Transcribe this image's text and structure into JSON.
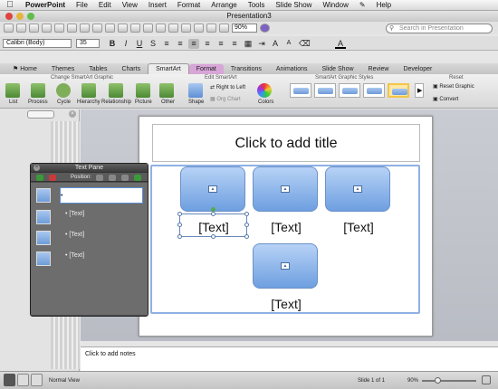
{
  "menubar": {
    "apple": "",
    "app": "PowerPoint",
    "items": [
      "File",
      "Edit",
      "View",
      "Insert",
      "Format",
      "Arrange",
      "Tools",
      "Slide Show",
      "Window"
    ],
    "help": "Help"
  },
  "window": {
    "title": "Presentation3"
  },
  "toolbar": {
    "zoom": "90%",
    "search_placeholder": "Search in Presentation"
  },
  "format_bar": {
    "font": "Calibri (Body)",
    "size": "35"
  },
  "ribbon": {
    "tabs": [
      "Home",
      "Themes",
      "Tables",
      "Charts",
      "SmartArt",
      "Format",
      "Transitions",
      "Animations",
      "Slide Show",
      "Review",
      "Developer"
    ],
    "group_titles": {
      "change": "Change SmartArt Graphic",
      "edit": "Edit SmartArt",
      "styles": "SmartArt Graphic Styles",
      "reset": "Reset"
    },
    "buttons": {
      "list": "List",
      "process": "Process",
      "cycle": "Cycle",
      "hierarchy": "Hierarchy",
      "relationship": "Relationship",
      "picture": "Picture",
      "other": "Other",
      "shape": "Shape",
      "right_to_left": "Right to Left",
      "org_chart": "Org Chart",
      "colors": "Colors",
      "reset_graphic": "Reset Graphic",
      "convert": "Convert"
    }
  },
  "slide": {
    "title_placeholder": "Click to add title",
    "items": [
      "[Text]",
      "[Text]",
      "[Text]",
      "[Text]"
    ]
  },
  "text_pane": {
    "title": "Text Pane",
    "position_label": "Position:",
    "rows": [
      "",
      "[Text]",
      "[Text]",
      "[Text]"
    ]
  },
  "notes": {
    "placeholder": "Click to add notes"
  },
  "status": {
    "view": "Normal View",
    "slide": "Slide 1 of 1",
    "zoom": "90%"
  }
}
